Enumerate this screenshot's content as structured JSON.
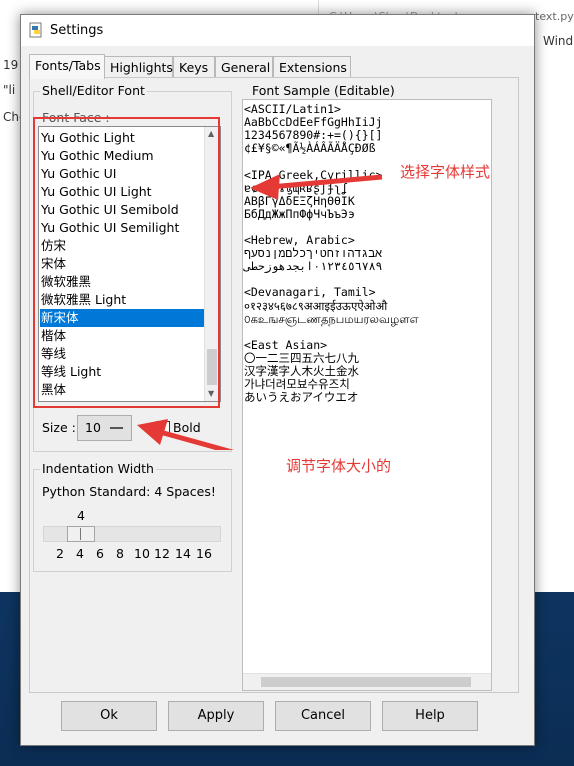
{
  "background": {
    "left_lines": [
      "19",
      "\"li",
      "Che"
    ],
    "right_title": "text.py",
    "right_path_fragment": "C:\\Users\\Shou\\Desktop\\",
    "right_menu": [
      "ions",
      "Wind"
    ]
  },
  "dialog": {
    "title": "Settings",
    "tabs": [
      "Fonts/Tabs",
      "Highlights",
      "Keys",
      "General",
      "Extensions"
    ],
    "active_tab": "Fonts/Tabs"
  },
  "shell_font": {
    "section_title": "Shell/Editor Font",
    "font_face_label": "Font Face :",
    "fonts": [
      "Yu Gothic Light",
      "Yu Gothic Medium",
      "Yu Gothic UI",
      "Yu Gothic UI Light",
      "Yu Gothic UI Semibold",
      "Yu Gothic UI Semilight",
      "仿宋",
      "宋体",
      "微软雅黑",
      "微软雅黑 Light",
      "新宋体",
      "楷体",
      "等线",
      "等线 Light",
      "黑体"
    ],
    "selected_font": "新宋体",
    "size_label": "Size :",
    "size_value": "10",
    "bold_label": "Bold",
    "bold_checked": false
  },
  "indentation": {
    "section_title": "Indentation Width",
    "description": "Python Standard: 4 Spaces!",
    "current_value": "4",
    "tick_labels": [
      "2",
      "4",
      "6",
      "8",
      "10",
      "12",
      "14",
      "16"
    ]
  },
  "font_sample": {
    "section_title": "Font Sample (Editable)",
    "lines": [
      "<ASCII/Latin1>",
      "AaBbCcDdEeFfGgHhIiJj",
      "1234567890#:+=(){}[]",
      "¢£¥§©«¶Ã½ÀÁÂÃÄÅÇÐØß",
      "",
      "<IPA,Greek,Cyrillic>",
      "ɐɕɘɞɟɤɮɰʀʁʂʃʄʅʆ",
      "ΑΒβΓγΔδΕΞζΗηΘθΙΚ",
      "БбДдЖжПпФфЧчЪъЭэ",
      "",
      "<Hebrew, Arabic>",
      "אבגדהוזחטיךכלםמןנסעף",
      "٠١٢٣٤٥٦٧٨٩ابجدهوزحطی",
      "",
      "<Devanagari, Tamil>",
      "०१२३४५६७८९अआइईउऊएऐओऔ",
      "௦கஉஙசஞடணதநபமயரலவழளஎ",
      "",
      "<East Asian>",
      "〇一二三四五六七八九",
      "汉字漢字人木火土金水",
      "가냐더려모뵤수유즈치",
      "あいうえおアイウエオ"
    ]
  },
  "buttons": {
    "ok": "Ok",
    "apply": "Apply",
    "cancel": "Cancel",
    "help": "Help"
  },
  "annotations": {
    "font_style": "选择字体样式",
    "font_size": "调节字体大小的"
  },
  "colors": {
    "selection": "#0078d7",
    "annotation_red": "#e53935"
  }
}
